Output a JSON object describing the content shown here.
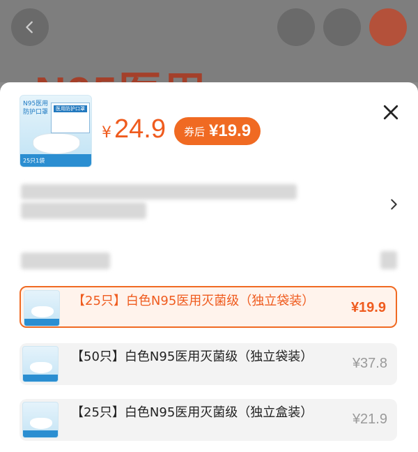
{
  "background": {
    "title_partial": "N95医用"
  },
  "product": {
    "thumbnail": {
      "label": "N95医用防护口罩",
      "box_text": "医用防护口罩",
      "footer": "25只1袋"
    },
    "currency": "¥",
    "price": "24.9",
    "coupon_tag": "券后",
    "coupon_price": "¥19.9"
  },
  "options": [
    {
      "name": "【25只】白色N95医用灭菌级（独立袋装）",
      "price": "¥19.9",
      "selected": true
    },
    {
      "name": "【50只】白色N95医用灭菌级（独立袋装）",
      "price": "¥37.8",
      "selected": false
    },
    {
      "name": "【25只】白色N95医用灭菌级（独立盒装）",
      "price": "¥21.9",
      "selected": false
    }
  ],
  "icons": {
    "back": "chevron-left-icon",
    "close": "close-icon",
    "more": "chevron-right-icon"
  },
  "colors": {
    "accent": "#ef5b1e",
    "coupon_bg": "#f06a22",
    "selected_bg": "#fff3ec"
  }
}
